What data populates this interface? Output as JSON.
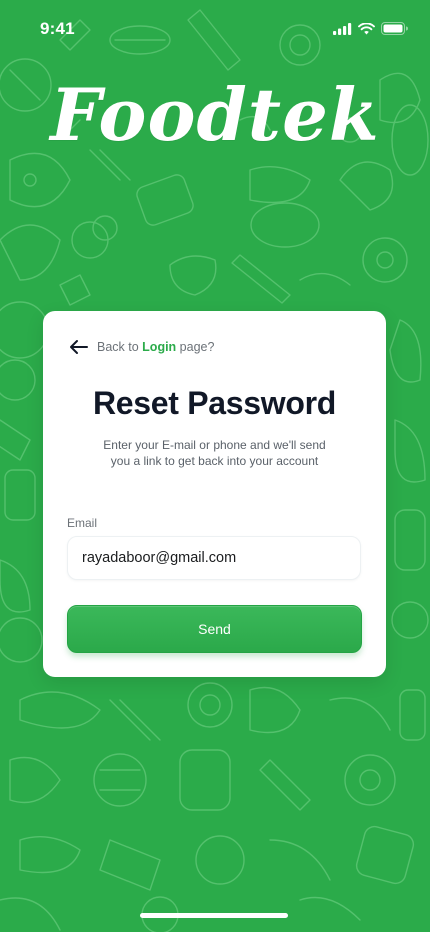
{
  "status_bar": {
    "time": "9:41"
  },
  "logo": {
    "text": "Foodtek"
  },
  "reset_card": {
    "back_prefix": "Back to ",
    "back_link": "Login",
    "back_suffix": " page?",
    "title": "Reset Password",
    "subtitle": "Enter your E-mail or phone and we'll send you a link to get back into your account",
    "email_label": "Email",
    "email_value": "rayadaboor@gmail.com",
    "send_label": "Send"
  },
  "colors": {
    "brand_green": "#2bab4a",
    "card_background": "#ffffff",
    "title_text": "#111827"
  },
  "icons": [
    "cellular-icon",
    "wifi-icon",
    "battery-icon",
    "back-arrow-icon"
  ]
}
